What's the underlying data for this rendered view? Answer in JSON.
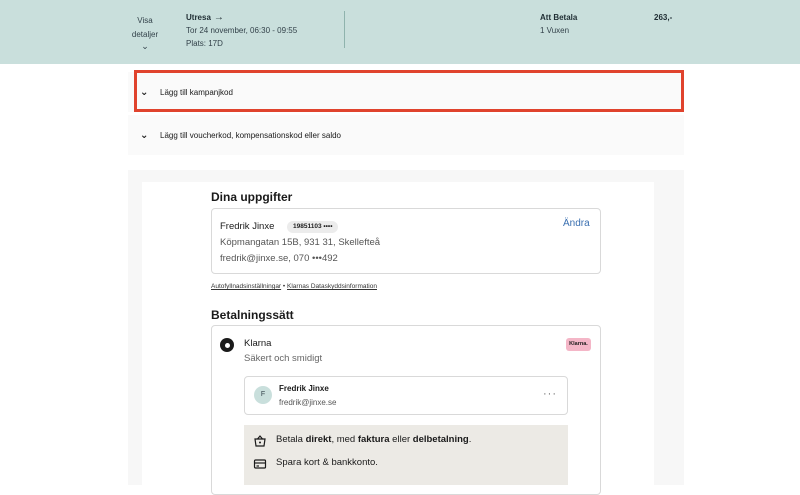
{
  "header": {
    "details_label_line1": "Visa",
    "details_label_line2": "detaljer",
    "trip_title": "Utresa",
    "trip_date": "Tor 24 november, 06:30 - 09:55",
    "trip_seat": "Plats: 17D",
    "pay_title": "Att Betala",
    "pay_passengers": "1 Vuxen",
    "price": "263,-"
  },
  "promo": {
    "campaign_label": "Lägg till kampanjkod",
    "voucher_label": "Lägg till voucherkod, kompensationskod eller saldo"
  },
  "details": {
    "heading": "Dina uppgifter",
    "name": "Fredrik Jinxe",
    "personal_number": "19851103 ••••",
    "address": "Köpmangatan 15B, 931 31, Skellefteå",
    "contact": "fredrik@jinxe.se, 070 •••492",
    "edit_label": "Ändra",
    "autofill_link": "Autofyllnadsinställningar",
    "separator": "•",
    "privacy_link": "Klarnas Dataskyddsinformation"
  },
  "payment": {
    "heading": "Betalningssätt",
    "method_name": "Klarna",
    "method_sub": "Säkert och smidigt",
    "logo_text": "Klarna.",
    "avatar_letter": "F",
    "user_name": "Fredrik Jinxe",
    "user_email": "fredrik@jinxe.se",
    "more": "···",
    "benefit1": {
      "a": "Betala ",
      "b": "direkt",
      "c": ", med ",
      "d": "faktura",
      "e": " eller ",
      "f": "delbetalning",
      "g": "."
    },
    "benefit2": "Spara kort & bankkonto."
  },
  "colors": {
    "header_bg": "#c9dfdc",
    "highlight": "#e0432d",
    "link": "#3a6fb0",
    "klarna_pink": "#f4b6c7"
  }
}
